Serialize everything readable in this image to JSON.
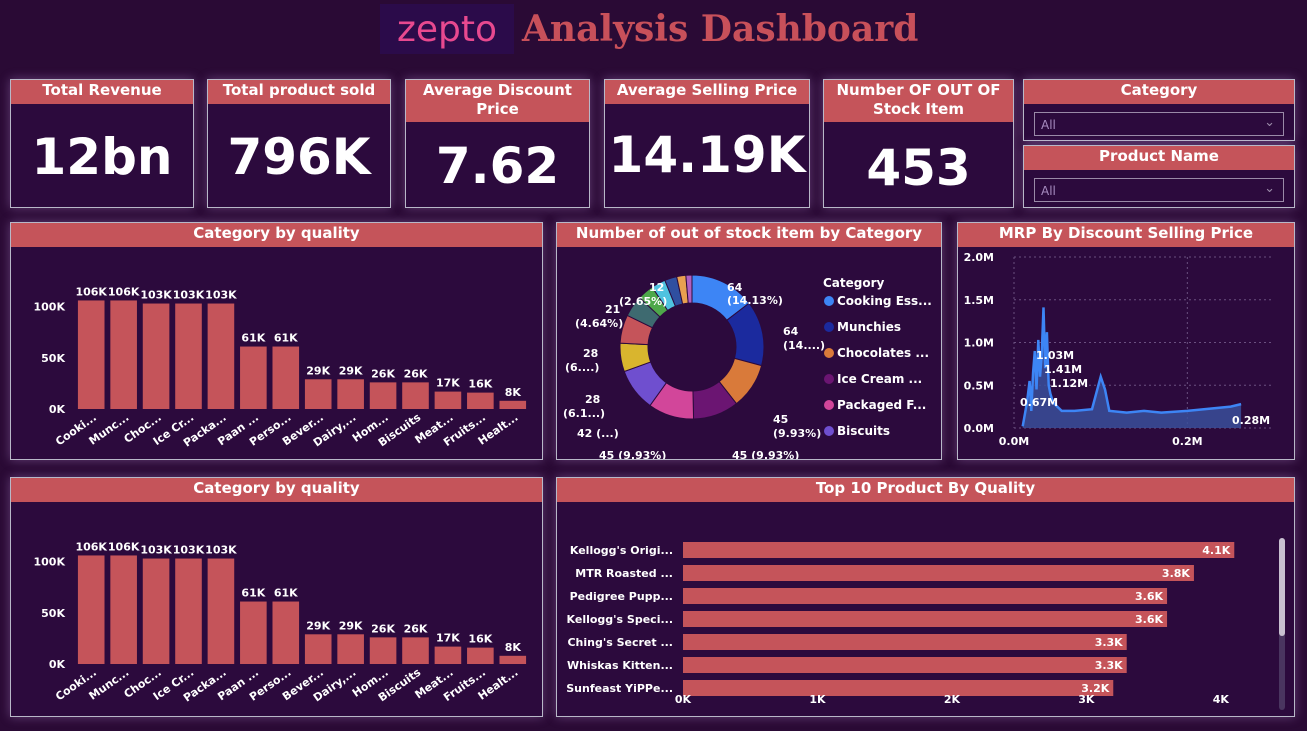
{
  "header": {
    "logo": "zepto",
    "title": "Analysis Dashboard"
  },
  "kpis": [
    {
      "label": "Total Revenue",
      "value": "12bn"
    },
    {
      "label": "Total product sold",
      "value": "796K"
    },
    {
      "label": "Average Discount Price",
      "value": "7.62"
    },
    {
      "label": "Average Selling Price",
      "value": "14.19K"
    },
    {
      "label": "Number OF OUT OF Stock Item",
      "value": "453"
    }
  ],
  "slicers": {
    "category": {
      "label": "Category",
      "value": "All"
    },
    "product": {
      "label": "Product Name",
      "value": "All"
    }
  },
  "colors": {
    "bar": "#c5545a",
    "panel": "#2c0a3d",
    "background": "#2a0a35",
    "header": "#c5545a",
    "area": "#3d85f5"
  },
  "chart_data": [
    {
      "id": "bar1",
      "type": "bar",
      "title": "Category by quality",
      "categories": [
        "Cooki...",
        "Munc...",
        "Choc...",
        "Ice Cr...",
        "Packa...",
        "Paan ...",
        "Perso...",
        "Bever...",
        "Dairy,...",
        "Hom...",
        "Biscuits",
        "Meat...",
        "Fruits...",
        "Healt..."
      ],
      "values": [
        106,
        106,
        103,
        103,
        103,
        61,
        61,
        29,
        29,
        26,
        26,
        17,
        16,
        8
      ],
      "data_labels": [
        "106K",
        "106K",
        "103K",
        "103K",
        "103K",
        "61K",
        "61K",
        "29K",
        "29K",
        "26K",
        "26K",
        "17K",
        "16K",
        "8K"
      ],
      "yticks": [
        "0K",
        "50K",
        "100K"
      ],
      "ylim": [
        0,
        125
      ]
    },
    {
      "id": "donut",
      "type": "pie",
      "title": "Number of out of stock item by Category",
      "legend_title": "Category",
      "legend": [
        "Cooking Ess...",
        "Munchies",
        "Chocolates ...",
        "Ice Cream ...",
        "Packaged F...",
        "Biscuits"
      ],
      "slices": [
        {
          "value": 64,
          "color": "#3d85f5"
        },
        {
          "value": 64,
          "color": "#1b2a9e"
        },
        {
          "value": 45,
          "color": "#d97a3a"
        },
        {
          "value": 45,
          "color": "#6b1572"
        },
        {
          "value": 45,
          "color": "#d2469a"
        },
        {
          "value": 42,
          "color": "#6f4fcf"
        },
        {
          "value": 28,
          "color": "#d9b52e"
        },
        {
          "value": 28,
          "color": "#c5545a"
        },
        {
          "value": 21,
          "color": "#3e6a70"
        },
        {
          "value": 16,
          "color": "#4ea84a"
        },
        {
          "value": 14,
          "color": "#4fc3e0"
        },
        {
          "value": 12,
          "color": "#2f4fa0"
        },
        {
          "value": 9,
          "color": "#e8a050"
        },
        {
          "value": 6,
          "color": "#b060c0"
        }
      ],
      "labels": [
        "64",
        "(14.13%)",
        "64",
        "(14....)",
        "45",
        "(9.93%)",
        "45 (9.93%)",
        "45 (9.93%)",
        "42 (...)",
        "28",
        "(6.1...)",
        "28",
        "(6....)",
        "21",
        "(4.64%)",
        "12",
        "(2.65%)"
      ]
    },
    {
      "id": "area",
      "type": "area",
      "title": "MRP By Discount Selling Price",
      "yticks": [
        "0.0M",
        "0.5M",
        "1.0M",
        "1.5M",
        "2.0M"
      ],
      "xticks": [
        "0.0M",
        "0.2M"
      ],
      "xlim": [
        0,
        0.3
      ],
      "ylim": [
        0,
        2.0
      ],
      "points": [
        [
          0.01,
          0.02
        ],
        [
          0.015,
          0.3
        ],
        [
          0.018,
          0.55
        ],
        [
          0.02,
          0.2
        ],
        [
          0.022,
          0.65
        ],
        [
          0.024,
          0.9
        ],
        [
          0.026,
          0.45
        ],
        [
          0.028,
          1.03
        ],
        [
          0.03,
          0.6
        ],
        [
          0.032,
          0.85
        ],
        [
          0.034,
          1.41
        ],
        [
          0.036,
          0.7
        ],
        [
          0.038,
          1.12
        ],
        [
          0.04,
          0.5
        ],
        [
          0.042,
          0.4
        ],
        [
          0.045,
          0.3
        ],
        [
          0.05,
          0.25
        ],
        [
          0.055,
          0.2
        ],
        [
          0.07,
          0.2
        ],
        [
          0.09,
          0.22
        ],
        [
          0.1,
          0.6
        ],
        [
          0.105,
          0.45
        ],
        [
          0.11,
          0.2
        ],
        [
          0.13,
          0.18
        ],
        [
          0.15,
          0.2
        ],
        [
          0.17,
          0.18
        ],
        [
          0.2,
          0.2
        ],
        [
          0.25,
          0.25
        ],
        [
          0.262,
          0.28
        ]
      ],
      "annotations": [
        "1.03M",
        "1.41M",
        "1.12M",
        "0.67M",
        "0.28M"
      ]
    },
    {
      "id": "bar2",
      "type": "bar",
      "title": "Category by quality",
      "categories": [
        "Cooki...",
        "Munc...",
        "Choc...",
        "Ice Cr...",
        "Packa...",
        "Paan ...",
        "Perso...",
        "Bever...",
        "Dairy,...",
        "Hom...",
        "Biscuits",
        "Meat...",
        "Fruits...",
        "Healt..."
      ],
      "values": [
        106,
        106,
        103,
        103,
        103,
        61,
        61,
        29,
        29,
        26,
        26,
        17,
        16,
        8
      ],
      "data_labels": [
        "106K",
        "106K",
        "103K",
        "103K",
        "103K",
        "61K",
        "61K",
        "29K",
        "29K",
        "26K",
        "26K",
        "17K",
        "16K",
        "8K"
      ],
      "yticks": [
        "0K",
        "50K",
        "100K"
      ],
      "ylim": [
        0,
        125
      ]
    },
    {
      "id": "hbar",
      "type": "bar",
      "orientation": "horizontal",
      "title": "Top 10 Product By Quality",
      "categories": [
        "Kellogg's Origi...",
        "MTR Roasted ...",
        "Pedigree Pupp...",
        "Kellogg's Speci...",
        "Ching's Secret ...",
        "Whiskas Kitten...",
        "Sunfeast YiPPe..."
      ],
      "values": [
        4.1,
        3.8,
        3.6,
        3.6,
        3.3,
        3.3,
        3.2
      ],
      "data_labels": [
        "4.1K",
        "3.8K",
        "3.6K",
        "3.6K",
        "3.3K",
        "3.3K",
        "3.2K"
      ],
      "xticks": [
        "0K",
        "1K",
        "2K",
        "3K",
        "4K"
      ],
      "xlim": [
        0,
        4.15
      ]
    }
  ]
}
